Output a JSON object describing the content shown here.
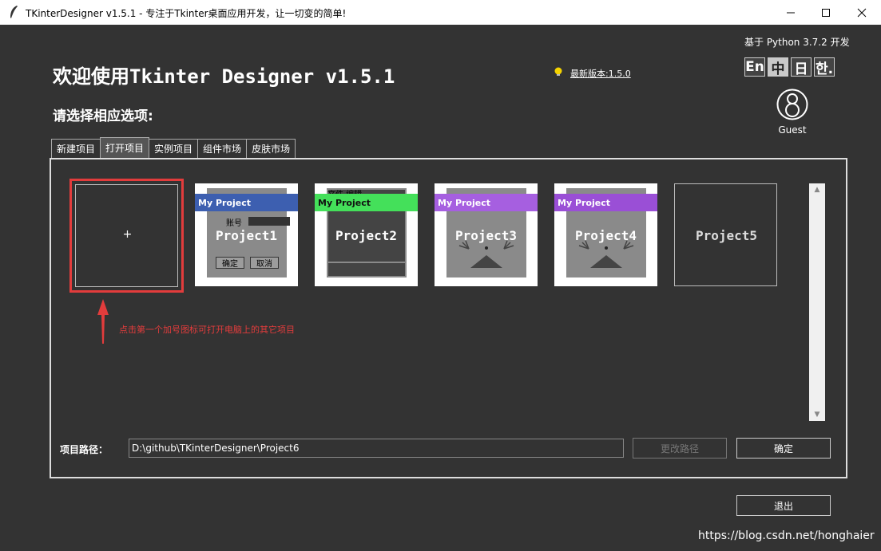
{
  "window": {
    "title": "TKinterDesigner v1.5.1 - 专注于Tkinter桌面应用开发，让一切变的简单!"
  },
  "header": {
    "python_info": "基于 Python 3.7.2 开发",
    "welcome": "欢迎使用Tkinter Designer v1.5.1",
    "latest_version": "最新版本:1.5.0",
    "prompt": "请选择相应选项:",
    "guest": "Guest"
  },
  "languages": [
    "En",
    "中",
    "日",
    "한."
  ],
  "tabs": [
    "新建项目",
    "打开项目",
    "实例项目",
    "组件市场",
    "皮肤市场"
  ],
  "projects": {
    "new_plus": "+",
    "p1": {
      "bar": "My Project",
      "name": "Project1",
      "account_label": "账号",
      "ok": "确定",
      "cancel": "取消"
    },
    "p2": {
      "bar": "My Project",
      "name": "Project2",
      "menu": "文件 编辑"
    },
    "p3": {
      "bar": "My Project",
      "name": "Project3"
    },
    "p4": {
      "bar": "My Project",
      "name": "Project4"
    },
    "p5": {
      "name": "Project5"
    }
  },
  "hint": "点击第一个加号图标可打开电脑上的其它项目",
  "footer": {
    "path_label": "项目路径：",
    "path_value": "D:\\github\\TKinterDesigner\\Project6",
    "change_path": "更改路径",
    "confirm": "确定",
    "exit": "退出"
  },
  "watermark": "https://blog.csdn.net/honghaier",
  "colors": {
    "background": "#333333",
    "p1_bar": "#3d5fb0",
    "p2_bar": "#44e05a",
    "p3_bar": "#a65fe0",
    "p4_bar": "#9a4fd6",
    "hint_red": "#e23c3c"
  }
}
